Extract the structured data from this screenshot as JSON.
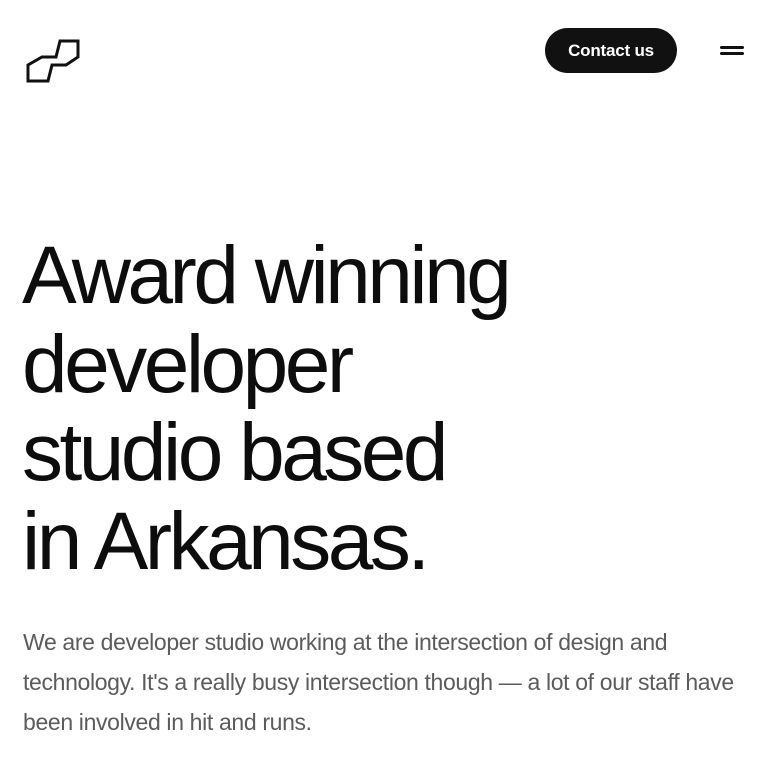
{
  "header": {
    "logo_icon": "brand-logo-icon",
    "contact_label": "Contact us",
    "menu_icon": "hamburger-menu-icon"
  },
  "hero": {
    "title_lines": [
      "Award winning",
      "developer",
      "studio based",
      "in Arkansas."
    ],
    "description": "We are developer studio working at the intersection of design and technology. It's a really busy intersection though — a lot of our staff have been involved in hit and runs."
  },
  "colors": {
    "background": "#ffffff",
    "text_primary": "#111111",
    "text_secondary": "#5b5b5b",
    "button_bg": "#111111",
    "button_text": "#ffffff"
  }
}
